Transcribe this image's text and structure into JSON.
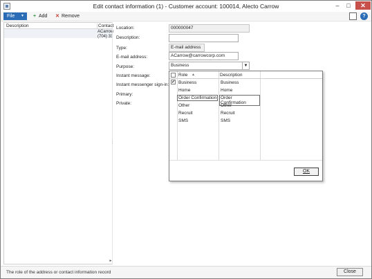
{
  "window": {
    "title": "Edit contact information (1) - Customer account: 100014, Alecto Carrow",
    "controls": {
      "minimize": "–",
      "maximize": "□",
      "close": "✕"
    }
  },
  "toolbar": {
    "file_label": "File",
    "file_caret": "▼",
    "add_label": "Add",
    "add_icon": "+",
    "remove_label": "Remove",
    "remove_icon": "✕",
    "help_icon": "?"
  },
  "list": {
    "columns": [
      "Description",
      "Contact"
    ],
    "rows": [
      {
        "description": "",
        "contact_line1": "ACarrow",
        "contact_line2": "(704) 33"
      }
    ]
  },
  "form": {
    "location": {
      "label": "Location:",
      "value": "000000047"
    },
    "description": {
      "label": "Description:",
      "value": ""
    },
    "type": {
      "label": "Type:",
      "value": "E-mail address"
    },
    "email": {
      "label": "E-mail address:",
      "value": "ACarrow@carrowcorp.com"
    },
    "purpose": {
      "label": "Purpose:",
      "value": "Business"
    },
    "instant_message": {
      "label": "Instant message:"
    },
    "instant_signin": {
      "label": "Instant messenger sign-in:"
    },
    "primary": {
      "label": "Primary:"
    },
    "private": {
      "label": "Private:"
    }
  },
  "lookup": {
    "headers": {
      "role": "Role",
      "description": "Description",
      "sort_icon": "▲"
    },
    "rows": [
      {
        "role": "Business",
        "description": "Business",
        "checked": true,
        "check": "✔"
      },
      {
        "role": "Home",
        "description": "Home",
        "checked": false
      },
      {
        "role": "Order Confirmation",
        "description": "Order Confirmation",
        "checked": false
      },
      {
        "role": "Other",
        "description": "Other",
        "checked": false
      },
      {
        "role": "Recruit",
        "description": "Recruit",
        "checked": false
      },
      {
        "role": "SMS",
        "description": "SMS",
        "checked": false
      }
    ],
    "ok_label": "OK"
  },
  "status": {
    "text": "The role of the address or contact information record",
    "close_label": "Close"
  }
}
